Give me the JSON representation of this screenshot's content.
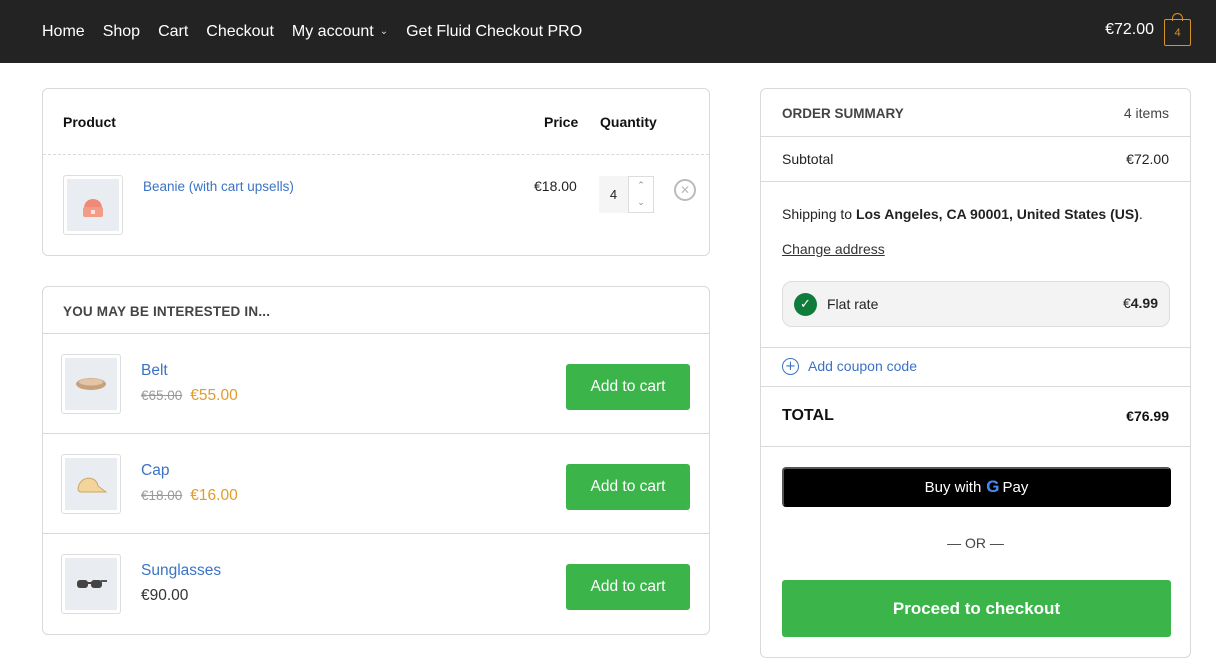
{
  "nav": {
    "items": [
      {
        "label": "Home"
      },
      {
        "label": "Shop"
      },
      {
        "label": "Cart"
      },
      {
        "label": "Checkout"
      },
      {
        "label": "My account",
        "has_dropdown": true
      },
      {
        "label": "Get Fluid Checkout PRO"
      }
    ],
    "cart_total": "€72.00",
    "cart_count": "4"
  },
  "cart": {
    "headers": {
      "product": "Product",
      "price": "Price",
      "quantity": "Quantity"
    },
    "items": [
      {
        "name": "Beanie (with cart upsells)",
        "price": "€18.00",
        "quantity": "4",
        "icon": "beanie-image"
      }
    ]
  },
  "upsells": {
    "title": "YOU MAY BE INTERESTED IN...",
    "items": [
      {
        "name": "Belt",
        "old_price": "€65.00",
        "price": "€55.00",
        "on_sale": true,
        "button": "Add to cart",
        "icon": "belt-image"
      },
      {
        "name": "Cap",
        "old_price": "€18.00",
        "price": "€16.00",
        "on_sale": true,
        "button": "Add to cart",
        "icon": "cap-image"
      },
      {
        "name": "Sunglasses",
        "old_price": "",
        "price": "€90.00",
        "on_sale": false,
        "button": "Add to cart",
        "icon": "sunglasses-image"
      }
    ]
  },
  "summary": {
    "title": "ORDER SUMMARY",
    "item_count": "4 items",
    "subtotal_label": "Subtotal",
    "subtotal": "€72.00",
    "shipping_prefix": "Shipping to ",
    "shipping_address": "Los Angeles, CA 90001, United States (US)",
    "shipping_suffix": ".",
    "change_address": "Change address",
    "shipping_method": "Flat rate",
    "shipping_currency": "€",
    "shipping_cost": "4.99",
    "coupon": "Add coupon code",
    "total_label": "TOTAL",
    "total": "€76.99",
    "gpay_prefix": "Buy with",
    "gpay_g": "G",
    "gpay_suffix": "Pay",
    "or": "— OR —",
    "proceed": "Proceed to checkout"
  },
  "colors": {
    "header_bg": "#232323",
    "accent_green": "#3bb54a",
    "link_blue": "#3b73c4",
    "sale_orange": "#e19c2c",
    "cart_badge": "#d3952a",
    "check_green": "#107c3c"
  }
}
